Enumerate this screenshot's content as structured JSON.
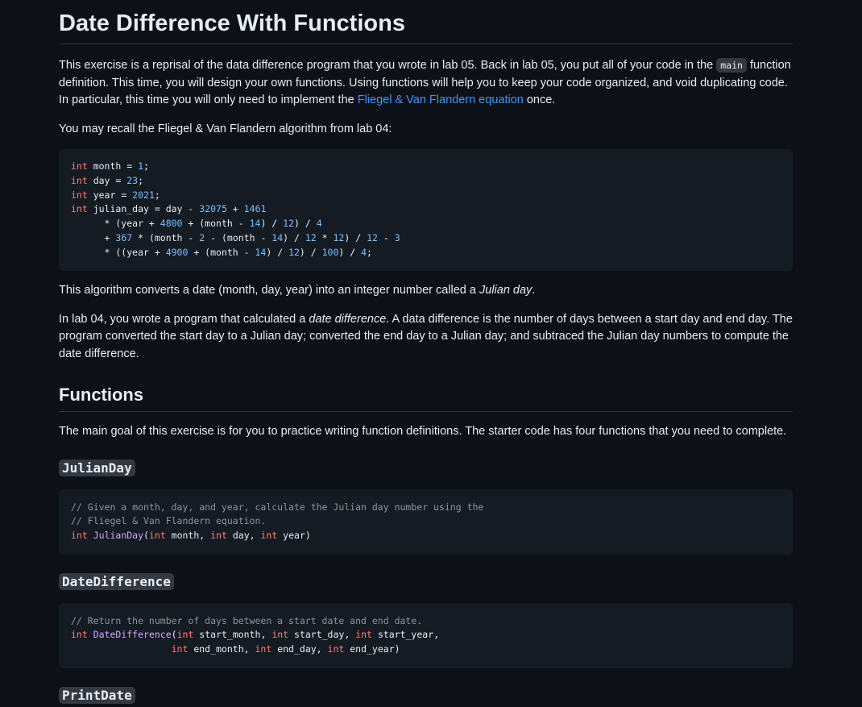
{
  "title": "Date Difference With Functions",
  "intro": {
    "p1_a": "This exercise is a reprisal of the data difference program that you wrote in lab 05. Back in lab 05, you put all of your code in the ",
    "p1_code": "main",
    "p1_b": " function definition. This time, you will design your own functions. Using functions will help you to keep your code organized, and void duplicating code. In particular, this time you will only need to implement the ",
    "p1_link": "Fliegel & Van Flandern equation",
    "p1_c": " once.",
    "p2": "You may recall the Fliegel & Van Flandern algorithm from lab 04:"
  },
  "algorithm_code": {
    "l1": [
      "int",
      " month = ",
      "1",
      ";"
    ],
    "l2": [
      "int",
      " day = ",
      "23",
      ";"
    ],
    "l3": [
      "int",
      " year = ",
      "2021",
      ";"
    ],
    "l4": [
      "int",
      " julian_day = day - ",
      "32075",
      " + ",
      "1461"
    ],
    "l5": [
      "      * (year + ",
      "4800",
      " + (month - ",
      "14",
      ") / ",
      "12",
      ") / ",
      "4"
    ],
    "l6": [
      "      + ",
      "367",
      " * (month - ",
      "2",
      " - (month - ",
      "14",
      ") / ",
      "12",
      " * ",
      "12",
      ") / ",
      "12",
      " - ",
      "3"
    ],
    "l7": [
      "      * ((year + ",
      "4900",
      " + (month - ",
      "14",
      ") / ",
      "12",
      ") / ",
      "100",
      ") / ",
      "4",
      ";"
    ]
  },
  "after_code": {
    "p3_a": "This algorithm converts a date (month, day, year) into an integer number called a ",
    "p3_em": "Julian day",
    "p3_b": ".",
    "p4_a": "In lab 04, you wrote a program that calculated a ",
    "p4_em": "date difference.",
    "p4_b": " A data difference is the number of days between a start day and end day. The program converted the start day to a Julian day; converted the end day to a Julian day; and subtraced the Julian day numbers to compute the date difference."
  },
  "functions_section": {
    "heading": "Functions",
    "intro": "The main goal of this exercise is for you to practice writing function definitions. The starter code has four functions that you need to complete."
  },
  "julian_day": {
    "heading": "JulianDay",
    "c1": "// Given a month, day, and year, calculate the Julian day number using the",
    "c2": "// Fliegel & Van Flandern equation.",
    "sig": [
      "int",
      " ",
      "JulianDay",
      "(",
      "int",
      " month, ",
      "int",
      " day, ",
      "int",
      " year)"
    ]
  },
  "date_difference": {
    "heading": "DateDifference",
    "c1": "// Return the number of days between a start date and end date.",
    "sig1": [
      "int",
      " ",
      "DateDifference",
      "(",
      "int",
      " start_month, ",
      "int",
      " start_day, ",
      "int",
      " start_year,"
    ],
    "sig2": [
      "                  ",
      "int",
      " end_month, ",
      "int",
      " end_day, ",
      "int",
      " end_year)"
    ]
  },
  "print_date": {
    "heading": "PrintDate"
  }
}
